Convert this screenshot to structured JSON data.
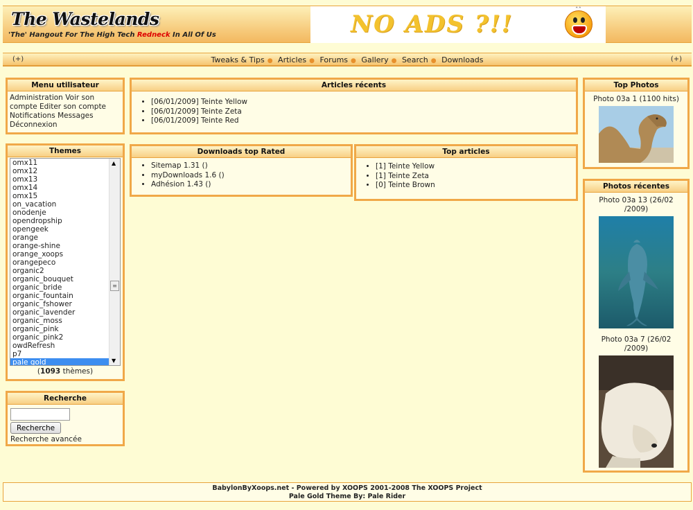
{
  "header": {
    "logo_title": "The Wastelands",
    "tagline_pre": "'The' Hangout For The High Tech ",
    "tagline_red": "Redneck",
    "tagline_post": " In All Of Us",
    "banner_text": "NO ADS ?!!"
  },
  "nav": {
    "toggle_left": "(+)",
    "toggle_right": "(+)",
    "links": [
      "Tweaks & Tips",
      "Articles",
      "Forums",
      "Gallery",
      "Search",
      "Downloads"
    ]
  },
  "user_menu": {
    "title": "Menu utilisateur",
    "links": [
      "Administration",
      "Voir son compte",
      "Editer son compte",
      "Notifications",
      "Messages",
      "Déconnexion"
    ]
  },
  "themes": {
    "title": "Themes",
    "options": [
      "omx11",
      "omx12",
      "omx13",
      "omx14",
      "omx15",
      "on_vacation",
      "onodenje",
      "opendropship",
      "opengeek",
      "orange",
      "orange-shine",
      "orange_xoops",
      "orangepeco",
      "organic2",
      "organic_bouquet",
      "organic_bride",
      "organic_fountain",
      "organic_fshower",
      "organic_lavender",
      "organic_moss",
      "organic_pink",
      "organic_pink2",
      "owdRefresh",
      "p7",
      "pale gold"
    ],
    "selected": "pale gold",
    "count": "1093",
    "count_label": "thèmes"
  },
  "search": {
    "title": "Recherche",
    "input_value": "",
    "button_label": "Recherche",
    "advanced_link": "Recherche avancée"
  },
  "recent_articles": {
    "title": "Articles récents",
    "items": [
      "[06/01/2009] Teinte Yellow",
      "[06/01/2009] Teinte Zeta",
      "[06/01/2009] Teinte Red"
    ]
  },
  "downloads_top": {
    "title": "Downloads top Rated",
    "items": [
      "Sitemap 1.31 ()",
      "myDownloads 1.6 ()",
      "Adhésion 1.43 ()"
    ]
  },
  "top_articles": {
    "title": "Top articles",
    "items": [
      "[1] Teinte Yellow",
      "[1] Teinte Zeta",
      "[0] Teinte Brown"
    ]
  },
  "top_photos": {
    "title": "Top Photos",
    "caption": "Photo 03a 1 (1100 hits)"
  },
  "recent_photos": {
    "title": "Photos récentes",
    "photo1_caption_l1": "Photo 03a 13 (26/02",
    "photo1_caption_l2": "/2009)",
    "photo2_caption_l1": "Photo 03a 7 (26/02",
    "photo2_caption_l2": "/2009)"
  },
  "footer": {
    "line1": "BabylonByXoops.net - Powered by XOOPS 2001-2008 The XOOPS Project",
    "line2": "Pale Gold Theme By: Pale Rider"
  }
}
